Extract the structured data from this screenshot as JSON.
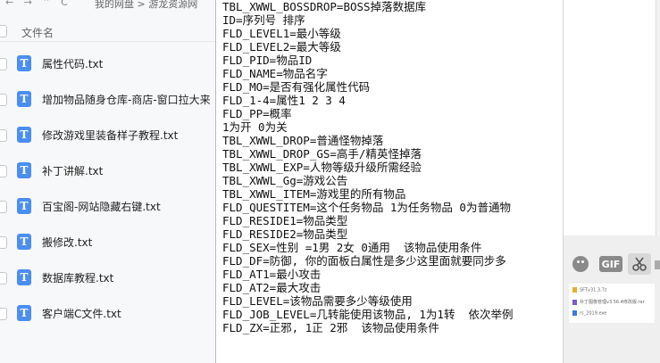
{
  "file_manager": {
    "nav_glyphs": "← → ⌃ C",
    "breadcrumb": "我的网盘 > 游龙资源网",
    "column_header": "文件名",
    "files": [
      {
        "name": "属性代码.txt"
      },
      {
        "name": "增加物品随身仓库-商店-窗口拉大来"
      },
      {
        "name": "修改游戏里装备样子教程.txt"
      },
      {
        "name": "补丁讲解.txt"
      },
      {
        "name": "百宝阁-网站隐藏右键.txt"
      },
      {
        "name": "搬修改.txt"
      },
      {
        "name": "数据库教程.txt"
      },
      {
        "name": "客户端C文件.txt"
      }
    ]
  },
  "text_document": {
    "lines": [
      "TBL_XWWL_BOSSDROP=BOSS掉落数据库",
      "ID=序列号 排序",
      "FLD_LEVEL1=最小等级",
      "FLD_LEVEL2=最大等级",
      "FLD_PID=物品ID",
      "FLD_NAME=物品名字",
      "FLD_MO=是否有强化属性代码",
      "FLD_1-4=属性1 2 3 4",
      "FLD_PP=概率",
      "1为开 0为关",
      "TBL_XWWL_DROP=普通怪物掉落",
      "TBL_XWWL_DROP_GS=高手/精英怪掉落",
      "TBL_XWWL_EXP=人物等级升级所需经验",
      "TBL_XWWL_Gg=游戏公告",
      "TBL_XWWL_ITEM=游戏里的所有物品",
      "FLD_QUESTITEM=这个任务物品 1为任务物品 0为普通物",
      "FLD_RESIDE1=物品类型",
      "FLD_RESIDE2=物品类型",
      "FLD_SEX=性别 =1男 2女 0通用  该物品使用条件",
      "FLD_DF=防御, 你的面板白属性是多少这里面就要同步多",
      "FLD_AT1=最小攻击",
      "FLD_AT2=最大攻击",
      "FLD_LEVEL=该物品需要多少等级使用",
      "FLD_JOB_LEVEL=几转能使用该物品, 1为1转  依次举例",
      "FLD_ZX=正邪, 1正 2邪  该物品使用条件"
    ]
  },
  "chat_panel": {
    "toolbar": {
      "emoji_icon": "emoji-icon",
      "gif_label": "GIF",
      "screenshot_icon": "scissors-icon"
    },
    "attached_files": [
      {
        "name": "SFTv31.3.7z",
        "color": "#e0b030"
      },
      {
        "name": "补丁图像管理v3.56.4修改版.rar",
        "color": "#7b5cc9"
      },
      {
        "name": "rs_2019.exe",
        "color": "#3d7be0"
      }
    ]
  },
  "colors": {
    "file_icon": "#4a8ef2",
    "panel_bg": "#f7f8fa"
  }
}
